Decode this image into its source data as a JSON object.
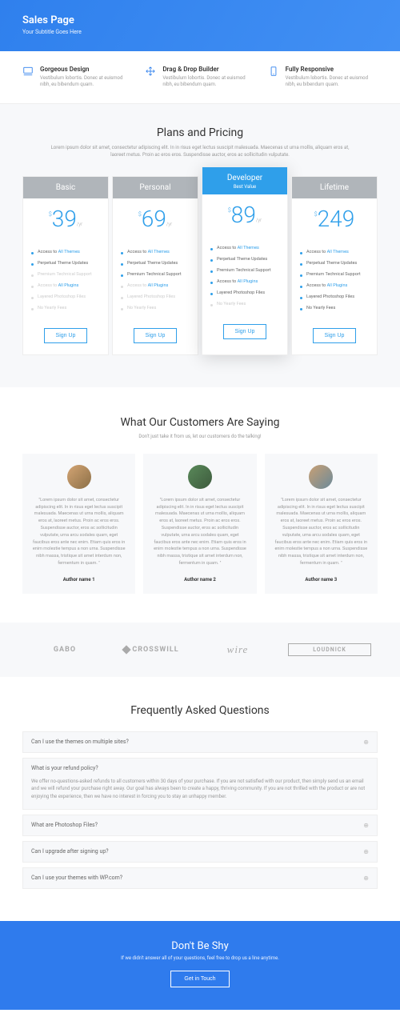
{
  "hero": {
    "title": "Sales Page",
    "subtitle": "Your Subtitle Goes Here"
  },
  "features": [
    {
      "title": "Gorgeous Design",
      "desc": "Vestibulum lobortis. Donec at euismod nibh, eu bibendum quam."
    },
    {
      "title": "Drag & Drop Builder",
      "desc": "Vestibulum lobortis. Donec at euismod nibh, eu bibendum quam."
    },
    {
      "title": "Fully Responsive",
      "desc": "Vestibulum lobortis. Donec at euismod nibh, eu bibendum quam."
    }
  ],
  "pricing": {
    "title": "Plans and Pricing",
    "sub": "Lorem ipsum dolor sit amet, consectetur adipiscing elit. In in risus eget lectus suscipit malesuada. Maecenas ut urna mollis, aliquam eros at, laoreet metus. Proin ac eros eros. Suspendisse auctor, eros ac sollicitudin vulputate.",
    "plans": [
      {
        "name": "Basic",
        "price": "39",
        "per": "/yr",
        "feat": false,
        "items": [
          {
            "t": "Access to ",
            "l": "All Themes",
            "dim": false
          },
          {
            "t": "Perpetual Theme Updates",
            "dim": false
          },
          {
            "t": "Premium Technical Support",
            "dim": true
          },
          {
            "t": "Access to ",
            "l": "All Plugins",
            "dim": true
          },
          {
            "t": "Layered Photoshop Files",
            "dim": true
          },
          {
            "t": "No Yearly Fees",
            "dim": true
          }
        ]
      },
      {
        "name": "Personal",
        "price": "69",
        "per": "/yr",
        "feat": false,
        "items": [
          {
            "t": "Access to ",
            "l": "All Themes",
            "dim": false
          },
          {
            "t": "Perpetual Theme Updates",
            "dim": false
          },
          {
            "t": "Premium Technical Support",
            "dim": false
          },
          {
            "t": "Access to ",
            "l": "All Plugins",
            "dim": true
          },
          {
            "t": "Layered Photoshop Files",
            "dim": true
          },
          {
            "t": "No Yearly Fees",
            "dim": true
          }
        ]
      },
      {
        "name": "Developer",
        "bv": "Best Value",
        "price": "89",
        "per": "/yr",
        "feat": true,
        "items": [
          {
            "t": "Access to ",
            "l": "All Themes",
            "dim": false
          },
          {
            "t": "Perpetual Theme Updates",
            "dim": false
          },
          {
            "t": "Premium Technical Support",
            "dim": false
          },
          {
            "t": "Access to ",
            "l": "All Plugins",
            "dim": false
          },
          {
            "t": "Layered Photoshop Files",
            "dim": false
          },
          {
            "t": "No Yearly Fees",
            "dim": true
          }
        ]
      },
      {
        "name": "Lifetime",
        "price": "249",
        "per": "",
        "feat": false,
        "items": [
          {
            "t": "Access to ",
            "l": "All Themes",
            "dim": false
          },
          {
            "t": "Perpetual Theme Updates",
            "dim": false
          },
          {
            "t": "Premium Technical Support",
            "dim": false
          },
          {
            "t": "Access to ",
            "l": "All Plugins",
            "dim": false
          },
          {
            "t": "Layered Photoshop Files",
            "dim": false
          },
          {
            "t": "No Yearly Fees",
            "dim": false
          }
        ]
      }
    ],
    "signup": "Sign Up"
  },
  "testimonials": {
    "title": "What Our Customers Are Saying",
    "sub": "Don't just take it from us, let our customers do the talking!",
    "body": "\"Lorem ipsum dolor sit amet, consectetur adipiscing elit. In in risus eget lectus suscipit malesuada. Maecenas ut urna mollis, aliquam eros at, laoreet metus. Proin ac eros eros. Suspendisse auctor, eros ac sollicitudin vulputate, urna arcu sodales quam, eget faucibus eros ante nec enim.\n\nEtiam quis eros in enim molestie tempus a non urna. Suspendisse nibh massa, tristique sit amet interdum non, fermentum in quam. \"",
    "authors": [
      "Author name 1",
      "Author name 2",
      "Author name 3"
    ]
  },
  "logos": [
    "GABO",
    "CROSSWILL",
    "wire",
    "LOUDNICK"
  ],
  "faq": {
    "title": "Frequently Asked Questions",
    "items": [
      {
        "q": "Can I use the themes on multiple sites?",
        "a": null
      },
      {
        "q": "What is your refund policy?",
        "a": "We offer no-questions-asked refunds to all customers within 30 days of your purchase. If you are not satisfied with our product, then simply send us an email and we will refund your purchase right away. Our goal has always been to create a happy, thriving community. If you are not thrilled with the product or are not enjoying the experience, then we have no interest in forcing you to stay an unhappy member."
      },
      {
        "q": "What are Photoshop Files?",
        "a": null
      },
      {
        "q": "Can I upgrade after signing up?",
        "a": null
      },
      {
        "q": "Can I use your themes with WP.com?",
        "a": null
      }
    ]
  },
  "cta": {
    "title": "Don't Be Shy",
    "sub": "If we didn't answer all of your questions, feel free to drop us a line anytime.",
    "btn": "Get in Touch"
  }
}
